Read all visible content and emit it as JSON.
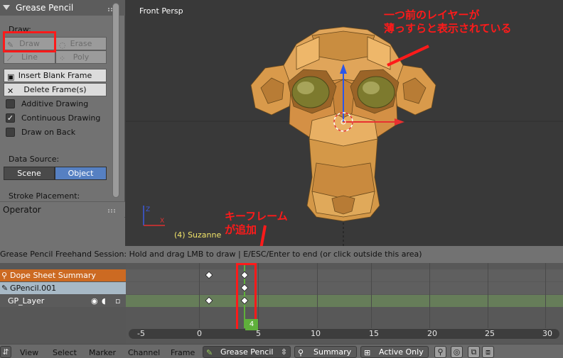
{
  "tool_shelf": {
    "panel_title": "Grease Pencil",
    "draw_label": "Draw:",
    "draw_button": "Draw",
    "erase_button": "Erase",
    "line_button": "Line",
    "poly_button": "Poly",
    "insert_blank_frame": "Insert Blank Frame",
    "delete_frames": "Delete Frame(s)",
    "additive_drawing": "Additive Drawing",
    "continuous_drawing": "Continuous Drawing",
    "draw_on_back": "Draw on Back",
    "data_source_label": "Data Source:",
    "source_scene": "Scene",
    "source_object": "Object",
    "stroke_placement_label": "Stroke Placement:",
    "operator_title": "Operator",
    "checkboxes": {
      "additive": false,
      "continuous": true,
      "on_back": false
    }
  },
  "viewport": {
    "view_name": "Front Persp",
    "object_label": "(4) Suzanne",
    "note_top_line1": "一つ前のレイヤーが",
    "note_top_line2": "薄っすらと表示されている",
    "note_mid_line1": "キーフレーム",
    "note_mid_line2": "が追加"
  },
  "status_bar": {
    "text": "Grease Pencil Freehand Session: Hold and drag LMB to draw | E/ESC/Enter to end  (or click outside this area)"
  },
  "dope_sheet": {
    "channels": [
      {
        "label": "Dope Sheet Summary",
        "color": "#cc6a22",
        "icon": "summary-icon"
      },
      {
        "label": "GPencil.001",
        "color": "#a7b9c6",
        "icon": "pencil-icon"
      },
      {
        "label": "GP_Layer",
        "color": "#5b5b5b",
        "icon": "none"
      }
    ],
    "layer_icons": [
      "eye-icon",
      "speaker-icon",
      "lock-icon"
    ],
    "keyframes": [
      1,
      4
    ],
    "current_frame": 4,
    "current_frame_label": "4",
    "ruler_ticks": [
      "-5",
      "0",
      "5",
      "10",
      "15",
      "20",
      "25",
      "30"
    ]
  },
  "toolbar": {
    "menus": [
      "View",
      "Select",
      "Marker",
      "Channel",
      "Frame"
    ],
    "mode": "Grease Pencil",
    "summary": "Summary",
    "active_only": "Active Only"
  },
  "colors": {
    "highlight_red": "#ff1a1a",
    "frame_green": "#5fb03b",
    "object_button_blue": "#5680c2"
  }
}
